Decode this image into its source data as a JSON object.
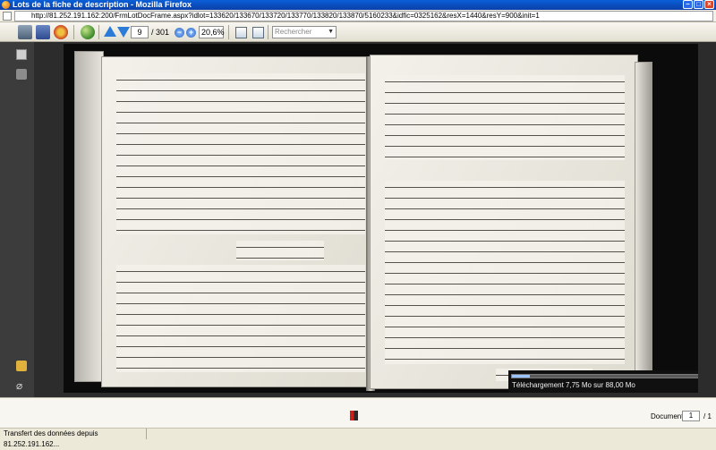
{
  "window": {
    "title": "Lots de la fiche de description - Mozilla Firefox"
  },
  "address_bar": {
    "url": "http://81.252.191.162:200/FrmLotDocFrame.aspx?idlot=133620/133670/133720/133770/133820/133870/5160233&idfic=0325162&resX=1440&resY=900&init=1"
  },
  "toolbar": {
    "page_current": "9",
    "page_total": "/ 301",
    "zoom": "20,6%",
    "search_placeholder": "Rechercher"
  },
  "download": {
    "text": "Téléchargement 7,75 Mo sur 88,00 Mo",
    "progress_fraction": 0.088
  },
  "document_nav": {
    "label": "Document",
    "current": "1",
    "total": "/ 1"
  },
  "status": {
    "text": "Transfert des données depuis 81.252.191.162..."
  }
}
